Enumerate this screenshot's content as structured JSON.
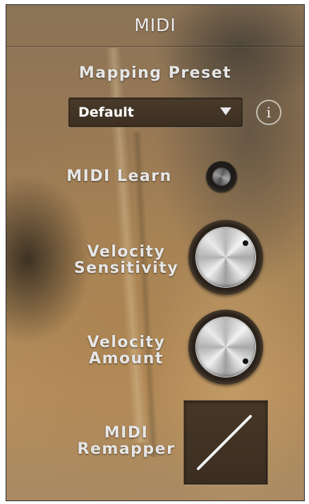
{
  "panel": {
    "title": "MIDI"
  },
  "mapping": {
    "label": "Mapping Preset",
    "value": "Default",
    "info_glyph": "i"
  },
  "midi_learn": {
    "label": "MIDI Learn"
  },
  "velocity_sensitivity": {
    "label_line1": "Velocity",
    "label_line2": "Sensitivity"
  },
  "velocity_amount": {
    "label_line1": "Velocity",
    "label_line2": "Amount"
  },
  "midi_remapper": {
    "label_line1": "MIDI",
    "label_line2": "Remapper",
    "curve": "linear"
  },
  "icons": {
    "dropdown": "triangle-down-icon",
    "info": "info-icon",
    "learn": "record-button-icon"
  },
  "colors": {
    "text": "#e6e6e6",
    "dropdown_bg": "#3f3226",
    "knob_face": "#dcdcdc"
  }
}
